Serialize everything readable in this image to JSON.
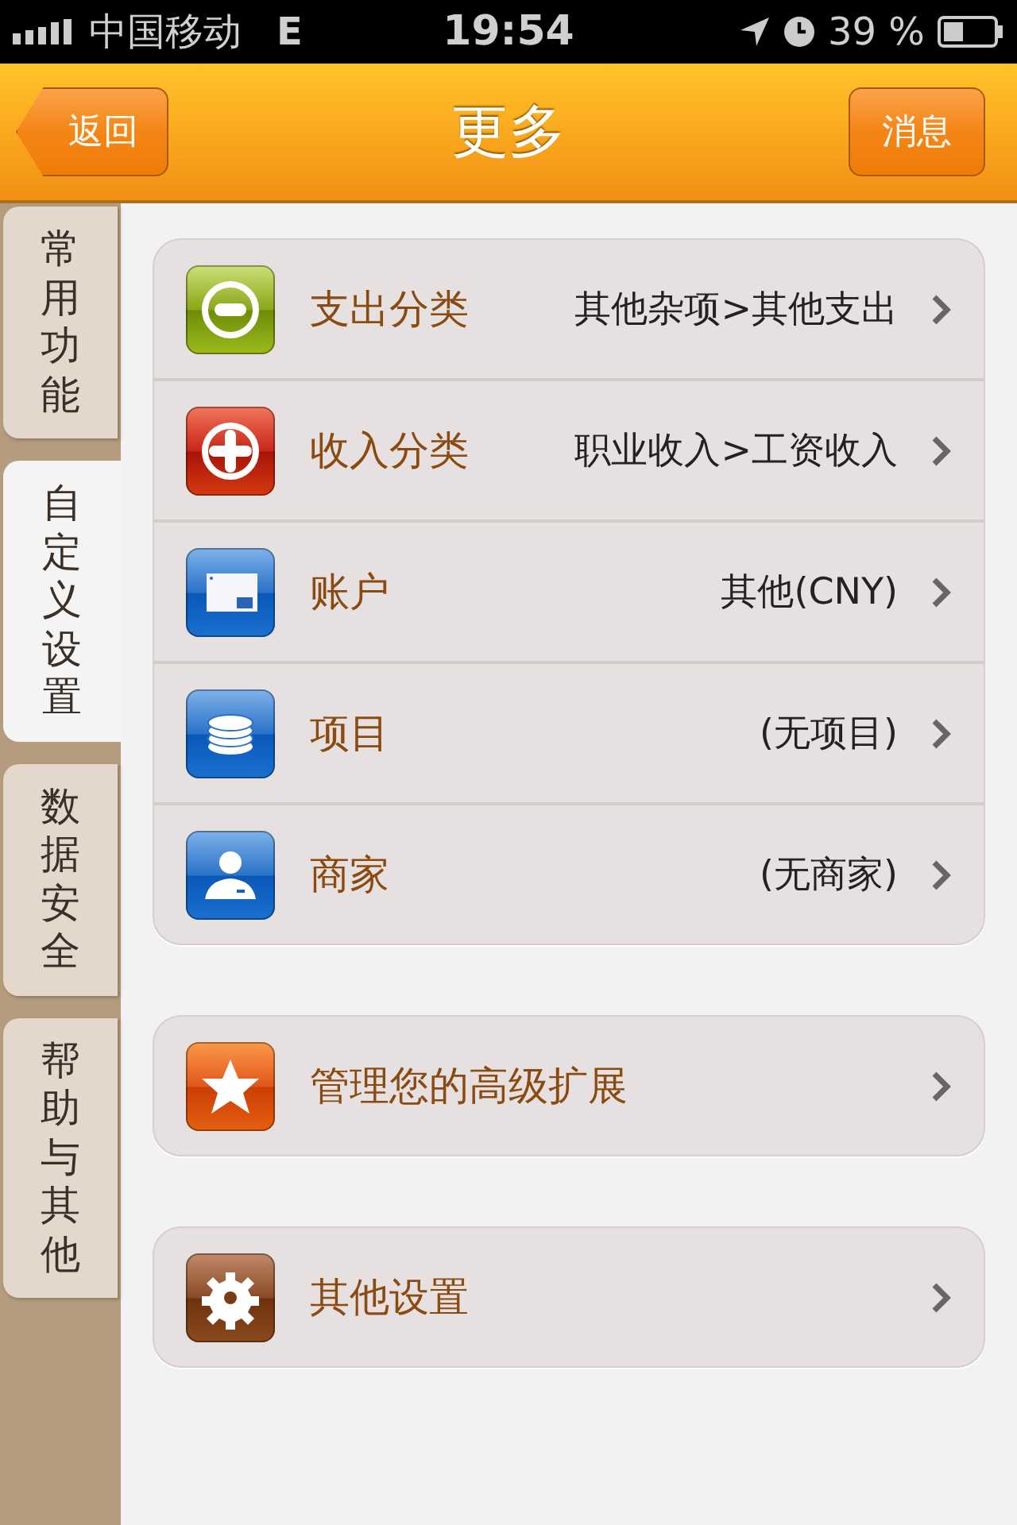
{
  "status_bar": {
    "carrier": "中国移动",
    "network": "E",
    "time": "19:54",
    "battery": "39 %"
  },
  "nav": {
    "back": "返回",
    "title": "更多",
    "right": "消息"
  },
  "sidebar": {
    "items": [
      {
        "label": "常用功能",
        "selected": false
      },
      {
        "label": "自定义设置",
        "selected": true
      },
      {
        "label": "数据安全",
        "selected": false
      },
      {
        "label": "帮助与其他",
        "selected": false
      }
    ]
  },
  "groups": [
    {
      "rows": [
        {
          "kind": "minus",
          "label": "支出分类",
          "value": "其他杂项>其他支出"
        },
        {
          "kind": "plus",
          "label": "收入分类",
          "value": "职业收入>工资收入"
        },
        {
          "kind": "card",
          "label": "账户",
          "value": "其他(CNY)"
        },
        {
          "kind": "coins",
          "label": "项目",
          "value": "(无项目)"
        },
        {
          "kind": "person",
          "label": "商家",
          "value": "(无商家)"
        }
      ]
    },
    {
      "rows": [
        {
          "kind": "star",
          "label": "管理您的高级扩展"
        }
      ]
    },
    {
      "rows": [
        {
          "kind": "gear",
          "label": "其他设置"
        }
      ]
    }
  ]
}
